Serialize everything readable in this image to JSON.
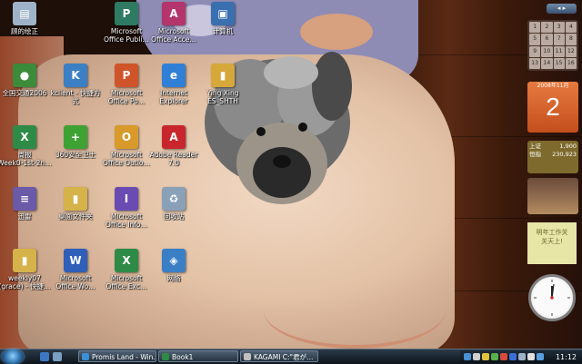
{
  "desktop_icons": [
    {
      "label": "顾的绘正",
      "color": "#9fb3c8",
      "glyph": "▤",
      "icon": "document-icon"
    },
    {
      "label": "Microsoft\nOffice Publi…",
      "color": "#2f7a63",
      "glyph": "P",
      "icon": "publisher-icon"
    },
    {
      "label": "Microsoft\nOffice Acce…",
      "color": "#b4346c",
      "glyph": "A",
      "icon": "access-icon"
    },
    {
      "label": "计算机",
      "color": "#3a6fb0",
      "glyph": "▣",
      "icon": "computer-icon"
    },
    {
      "label": "全国交通2006",
      "color": "#3c8b3a",
      "glyph": "●",
      "icon": "app-icon"
    },
    {
      "label": "kclient - 快捷方\n式",
      "color": "#3b7fc4",
      "glyph": "K",
      "icon": "shortcut-icon"
    },
    {
      "label": "Microsoft\nOffice Po…",
      "color": "#d0542a",
      "glyph": "P",
      "icon": "powerpoint-icon"
    },
    {
      "label": "Internet\nExplorer",
      "color": "#2f7fd6",
      "glyph": "e",
      "icon": "internet-explorer-icon"
    },
    {
      "label": "Ying Xing\nES_SHTH",
      "color": "#d6a83a",
      "glyph": "▮",
      "icon": "folder-icon"
    },
    {
      "label": "周报\nWeek0-1st-2n…",
      "color": "#2e8b47",
      "glyph": "X",
      "icon": "excel-file-icon"
    },
    {
      "label": "360安全卫士",
      "color": "#3ea233",
      "glyph": "+",
      "icon": "security-icon"
    },
    {
      "label": "Microsoft\nOffice Outlo…",
      "color": "#d89a2a",
      "glyph": "O",
      "icon": "outlook-icon"
    },
    {
      "label": "Adobe Reader\n7.0",
      "color": "#c8262c",
      "glyph": "A",
      "icon": "adobe-reader-icon"
    },
    {
      "label": "迅雷",
      "color": "#6a5aa8",
      "glyph": "≡",
      "icon": "app-icon"
    },
    {
      "label": "桌面文件夹",
      "color": "#d6b24a",
      "glyph": "▮",
      "icon": "folder-icon"
    },
    {
      "label": "Microsoft\nOffice Info…",
      "color": "#6a4bb2",
      "glyph": "I",
      "icon": "infopath-icon"
    },
    {
      "label": "回收站",
      "color": "#8aa0b8",
      "glyph": "♻",
      "icon": "recycle-bin-icon"
    },
    {
      "label": "weekly07\n(grace) - 快捷…",
      "color": "#d6b24a",
      "glyph": "▮",
      "icon": "folder-shortcut-icon"
    },
    {
      "label": "Microsoft\nOffice Wo…",
      "color": "#2f5fb8",
      "glyph": "W",
      "icon": "word-icon"
    },
    {
      "label": "Microsoft\nOffice Exc…",
      "color": "#2e8b47",
      "glyph": "X",
      "icon": "excel-icon"
    },
    {
      "label": "网络",
      "color": "#3a7fc6",
      "glyph": "◈",
      "icon": "network-icon"
    }
  ],
  "sidebar": {
    "toggle_label": "◂ ▸",
    "calendar_grid": [
      "1",
      "2",
      "3",
      "4",
      "5",
      "6",
      "7",
      "8",
      "9",
      "10",
      "11",
      "12",
      "13",
      "14",
      "15",
      "16"
    ],
    "calendar_day": {
      "month": "2008年11月",
      "day": "2"
    },
    "stocks": [
      {
        "name": "上证",
        "value": "1,900"
      },
      {
        "name": "恒指",
        "value": "230,923"
      }
    ],
    "note_text": "明年工作关\n关天上!"
  },
  "taskbar": {
    "tasks": [
      {
        "label": "Promis Land - Win…",
        "color": "#3a8fd6"
      },
      {
        "label": "Book1",
        "color": "#2e8b47"
      },
      {
        "label": "KAGAMI C:\"君が…",
        "color": "#c0c0c0"
      }
    ],
    "quick_launch_colors": [
      "#3c77c2",
      "#7a9fc2"
    ],
    "clock_time": "11:12",
    "tray_colors": [
      "#4a90d6",
      "#cfcfcf",
      "#e2c23a",
      "#58b04a",
      "#d84a3a",
      "#3a6fd6",
      "#9fb3c8",
      "#e0e0e0",
      "#58a0e0"
    ]
  }
}
